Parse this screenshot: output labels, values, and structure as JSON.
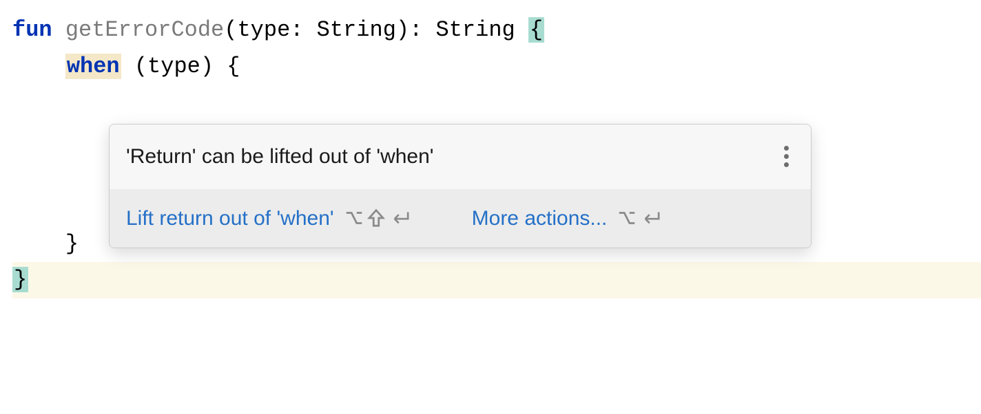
{
  "code": {
    "line1": {
      "fun": "fun",
      "funcName": "getErrorCode",
      "afterName": "(",
      "paramName": "type",
      "colon": ": ",
      "paramType": "String",
      "closeParen": ")",
      "returnColon": ": ",
      "returnType": "String",
      "space": " ",
      "openBrace": "{"
    },
    "line2": {
      "indent": "    ",
      "when": "when",
      "space": " ",
      "rest": "(type) {"
    },
    "line3": {
      "indent": "    ",
      "closeBrace": "}"
    },
    "line4": {
      "closeBrace": "}"
    }
  },
  "popup": {
    "title": "'Return' can be lifted out of 'when'",
    "action1": "Lift return out of 'when'",
    "action2": "More actions..."
  }
}
